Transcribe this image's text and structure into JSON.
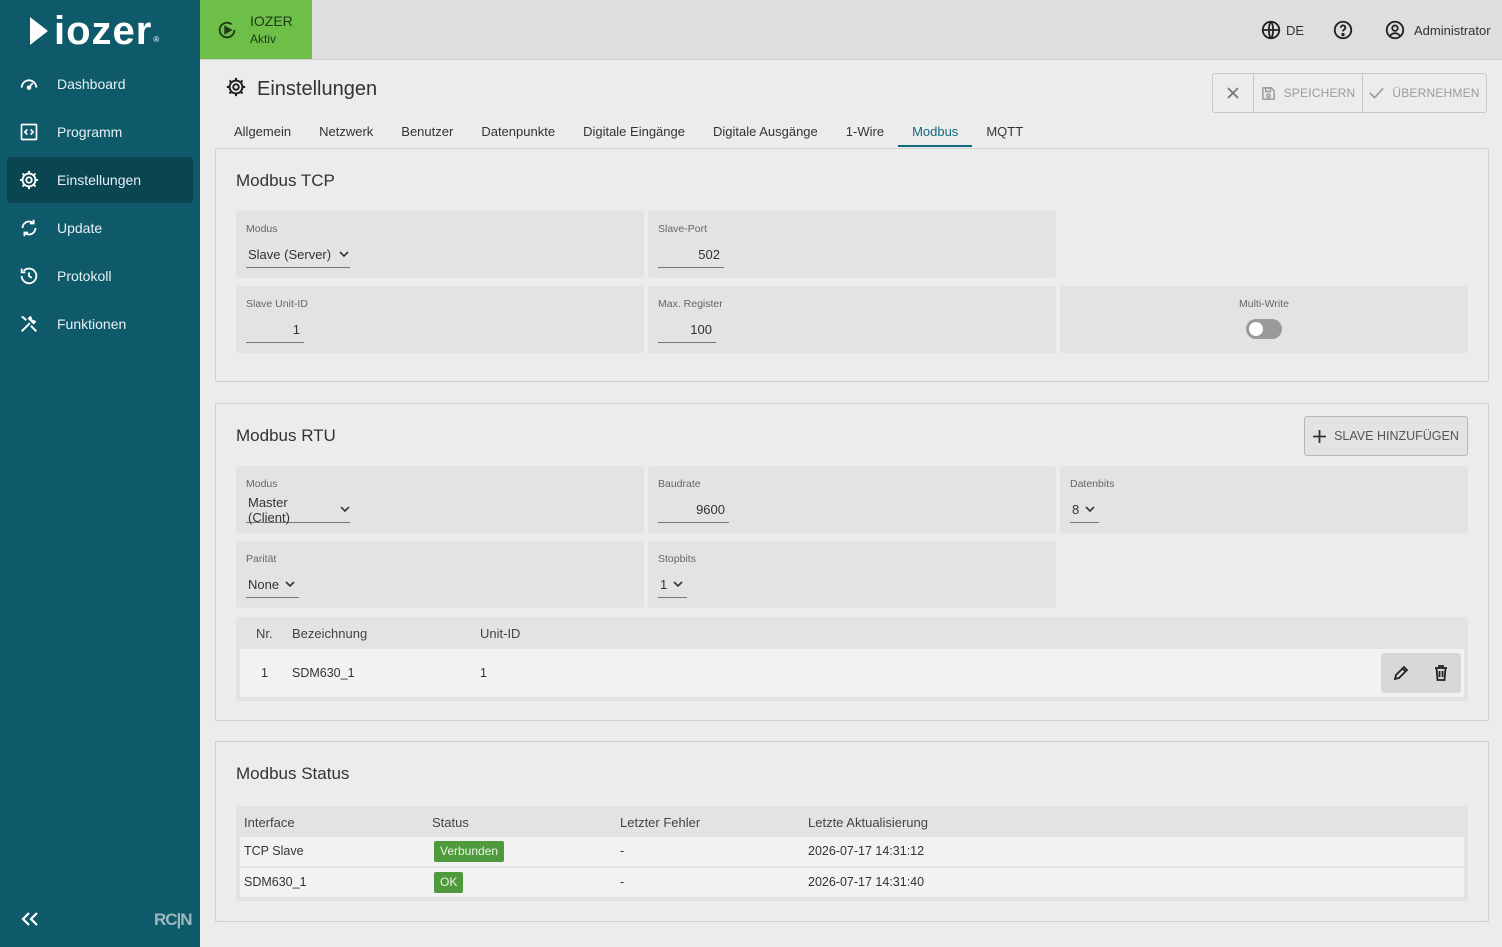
{
  "sidebar": {
    "logo_text": "IOZER",
    "logo_reg": "®",
    "items": [
      {
        "label": "Dashboard",
        "icon": "speedometer-icon"
      },
      {
        "label": "Programm",
        "icon": "code-icon"
      },
      {
        "label": "Einstellungen",
        "icon": "gear-icon",
        "active": true
      },
      {
        "label": "Update",
        "icon": "refresh-icon"
      },
      {
        "label": "Protokoll",
        "icon": "history-icon"
      },
      {
        "label": "Funktionen",
        "icon": "tools-icon"
      }
    ],
    "collapse_icon": "chevrons-left-icon",
    "footer_brand": "RC|N"
  },
  "topbar": {
    "device_name": "IOZER",
    "device_status": "Aktiv",
    "status_color": "#6ebe4a",
    "language": "DE",
    "user": "Administrator"
  },
  "page": {
    "title": "Einstellungen",
    "actions": {
      "close": "close-icon",
      "save": "SPEICHERN",
      "apply": "ÜBERNEHMEN"
    }
  },
  "tabs": [
    "Allgemein",
    "Netzwerk",
    "Benutzer",
    "Datenpunkte",
    "Digitale Eingänge",
    "Digitale Ausgänge",
    "1-Wire",
    "Modbus",
    "MQTT"
  ],
  "active_tab": "Modbus",
  "tcp": {
    "title": "Modbus TCP",
    "modus_label": "Modus",
    "modus_value": "Slave (Server)",
    "port_label": "Slave-Port",
    "port_value": "502",
    "unit_label": "Slave Unit-ID",
    "unit_value": "1",
    "maxreg_label": "Max. Register",
    "maxreg_value": "100",
    "multiwrite_label": "Multi-Write",
    "multiwrite_on": false
  },
  "rtu": {
    "title": "Modbus RTU",
    "add_slave": "SLAVE HINZUFÜGEN",
    "modus_label": "Modus",
    "modus_value": "Master (Client)",
    "baud_label": "Baudrate",
    "baud_value": "9600",
    "databits_label": "Datenbits",
    "databits_value": "8",
    "parity_label": "Parität",
    "parity_value": "None",
    "stopbits_label": "Stopbits",
    "stopbits_value": "1",
    "table": {
      "headers": [
        "Nr.",
        "Bezeichnung",
        "Unit-ID"
      ],
      "rows": [
        {
          "nr": "1",
          "name": "SDM630_1",
          "unit": "1"
        }
      ]
    }
  },
  "status": {
    "title": "Modbus Status",
    "headers": [
      "Interface",
      "Status",
      "Letzter Fehler",
      "Letzte Aktualisierung"
    ],
    "rows": [
      {
        "interface": "TCP Slave",
        "status": "Verbunden",
        "error": "-",
        "updated": "2026-07-17 14:31:12"
      },
      {
        "interface": "SDM630_1",
        "status": "OK",
        "error": "-",
        "updated": "2026-07-17 14:31:40"
      }
    ],
    "badge_color": "#4f9a3c"
  }
}
